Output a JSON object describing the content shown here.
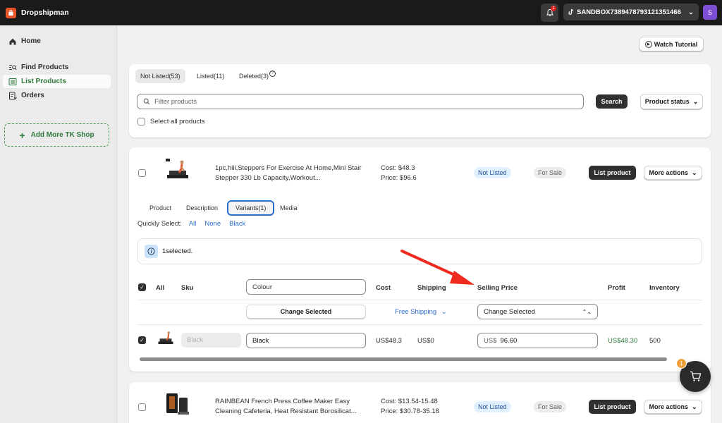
{
  "app": {
    "name": "Dropshipman"
  },
  "topbar": {
    "notification_count": "1",
    "store_name": "SANDBOX7389478793121351466",
    "avatar_letter": "S"
  },
  "sidebar": {
    "items": [
      {
        "label": "Home",
        "icon": "home-icon"
      },
      {
        "label": "Find Products",
        "icon": "find-products-icon"
      },
      {
        "label": "List Products",
        "icon": "list-icon",
        "active": true
      },
      {
        "label": "Orders",
        "icon": "orders-icon"
      }
    ],
    "add_shop_label": "Add More TK Shop"
  },
  "header": {
    "watch_tutorial_label": "Watch Tutorial"
  },
  "filters": {
    "tabs": [
      {
        "label": "Not Listed(53)",
        "selected": true
      },
      {
        "label": "Listed(11)"
      },
      {
        "label": "Deleted(3)"
      }
    ],
    "search_placeholder": "Filter products",
    "search_button": "Search",
    "status_button": "Product status",
    "select_all_label": "Select all products"
  },
  "products": [
    {
      "title": "1pc,hiii,Steppers For Exercise At Home,Mini Stair Stepper 330 Lb Capacity,Workout...",
      "cost": "Cost: $48.3",
      "price": "Price: $96.6",
      "status": "Not Listed",
      "sale_state": "For Sale",
      "list_button": "List product",
      "more_button": "More actions"
    },
    {
      "title": "RAINBEAN French Press Coffee Maker Easy Cleaning Cafeteria, Heat Resistant Borosilicat...",
      "cost": "Cost: $13.54-15.48",
      "price": "Price: $30.78-35.18",
      "status": "Not Listed",
      "sale_state": "For Sale",
      "list_button": "List product",
      "more_button": "More actions"
    }
  ],
  "detail_tabs": [
    {
      "label": "Product"
    },
    {
      "label": "Description"
    },
    {
      "label": "Variants(1)",
      "selected": true
    },
    {
      "label": "Media"
    }
  ],
  "quick_select": {
    "label": "Quickly Select:",
    "options": [
      "All",
      "None",
      "Black"
    ]
  },
  "selection_info": "1selected.",
  "variants_table": {
    "headers": {
      "all": "All",
      "sku": "Sku",
      "colour": "Colour",
      "cost": "Cost",
      "shipping": "Shipping",
      "selling_price": "Selling Price",
      "profit": "Profit",
      "inventory": "Inventory"
    },
    "bulk_row": {
      "change_selected_button": "Change Selected",
      "shipping_option": "Free Shipping",
      "price_dropdown": "Change Selected"
    },
    "rows": [
      {
        "sku_placeholder": "Black",
        "colour": "Black",
        "cost": "US$48.3",
        "shipping": "US$0",
        "price_currency": "US$",
        "price": "96.60",
        "profit": "US$48.30",
        "inventory": "500"
      }
    ]
  },
  "cart": {
    "count": "1"
  },
  "colors": {
    "topbar": "#1a1a1a",
    "accent_green": "#2f7a3d",
    "link_blue": "#2c6ecb",
    "brand_orange": "#e8542a",
    "annotation_arrow": "#f02a1e"
  }
}
